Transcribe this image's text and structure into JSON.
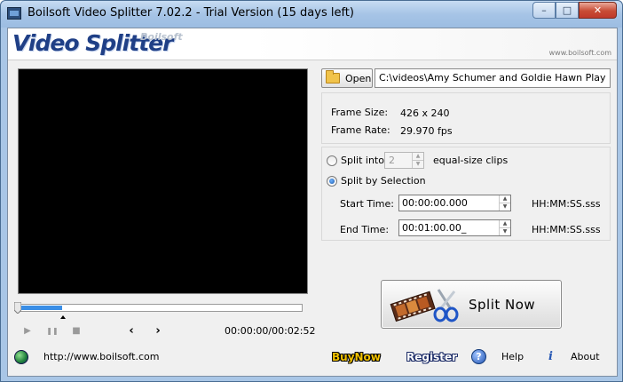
{
  "window": {
    "title": "Boilsoft Video Splitter 7.02.2 - Trial Version (15 days left)",
    "controls": {
      "minimize": "–",
      "maximize": "□",
      "close": "✕"
    }
  },
  "banner": {
    "logo": "Video Splitter",
    "logo_sub": "Boilsoft",
    "url": "www.boilsoft.com"
  },
  "player": {
    "position_fraction": 0.15,
    "timecode": "00:00:00/00:02:52",
    "play_icon": "▶",
    "pause_icon": "❚❚",
    "stop_icon": "■",
    "prev_icon": "‹",
    "next_icon": "›"
  },
  "file": {
    "open_label": "Open",
    "path": "C:\\videos\\Amy Schumer and Goldie Hawn Play 'Never"
  },
  "info": {
    "frame_size_label": "Frame Size:",
    "frame_size_value": "426 x 240",
    "frame_rate_label": "Frame Rate:",
    "frame_rate_value": "29.970 fps"
  },
  "options": {
    "split_into_label": "Split into",
    "split_into_value": "2",
    "equal_size_label": "equal-size clips",
    "split_by_selection_label": "Split by Selection",
    "selected": "split_by_selection",
    "start_time_label": "Start Time:",
    "start_time_value": "00:00:00.000",
    "end_time_label": "End Time:",
    "end_time_value": "00:01:00.00_",
    "format_hint": "HH:MM:SS.sss"
  },
  "action": {
    "split_now_label": "Split Now"
  },
  "status": {
    "website": "http://www.boilsoft.com",
    "buy_now": "BuyNow",
    "register": "Register",
    "help": "Help",
    "help_icon_glyph": "?",
    "about": "About",
    "about_icon_glyph": "i"
  }
}
